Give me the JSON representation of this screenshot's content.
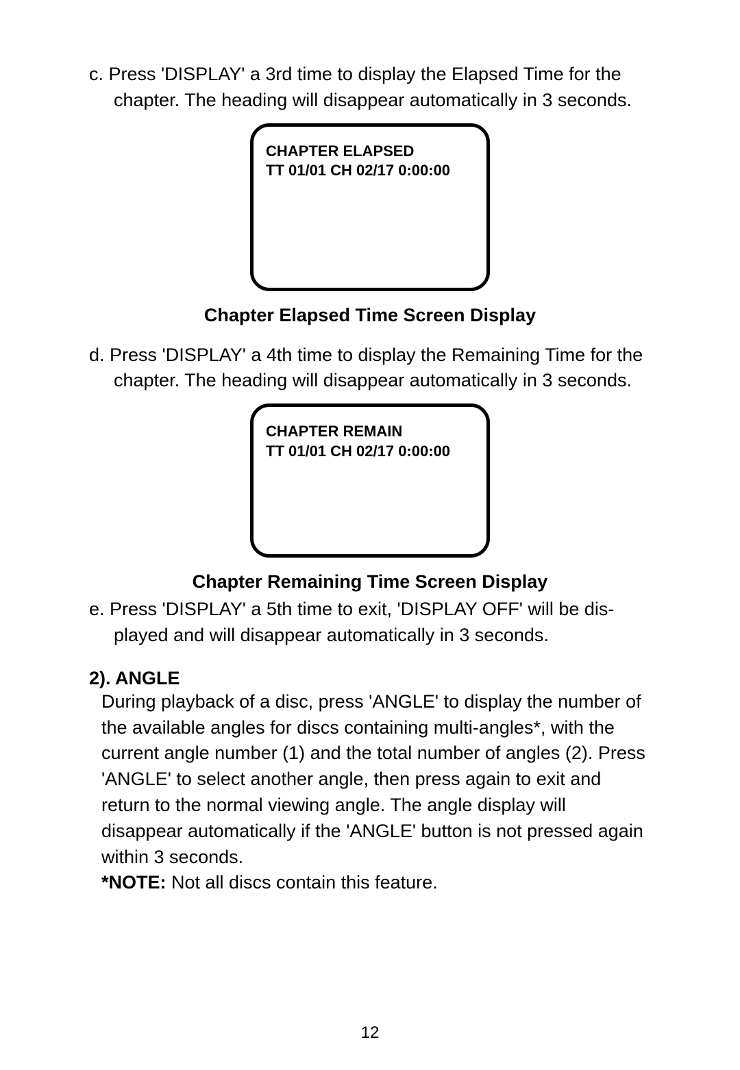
{
  "paras": {
    "c": "c. Press 'DISPLAY' a 3rd time to display the Elapsed Time for the chapter. The heading will disappear automatically in 3 seconds.",
    "d": "d. Press 'DISPLAY' a 4th time to display the Remaining Time for the chapter.  The heading will disappear automatically in 3 seconds.",
    "e": "e. Press 'DISPLAY' a 5th time to exit, 'DISPLAY OFF'  will be dis-played and will disappear automatically in 3 seconds."
  },
  "screens": {
    "elapsed": {
      "line1": "CHAPTER ELAPSED",
      "line2": "TT 01/01  CH 02/17  0:00:00",
      "caption": "Chapter Elapsed Time Screen Display"
    },
    "remain": {
      "line1": "CHAPTER REMAIN",
      "line2": "TT 01/01  CH 02/17  0:00:00",
      "caption": "Chapter Remaining Time Screen Display"
    }
  },
  "angle": {
    "heading": "2). ANGLE",
    "body": "During playback of a disc, press 'ANGLE' to display the  number of  the available angles for discs containing multi-angles*, with the current angle number (1) and the total number of angles (2). Press 'ANGLE' to select another angle, then press again to exit and return to the normal viewing angle.  The angle display will disappear automatically if the 'ANGLE' button is not pressed again within 3 seconds.",
    "note_label": "*NOTE:",
    "note_text": "  Not all discs contain this feature."
  },
  "page_number": "12"
}
